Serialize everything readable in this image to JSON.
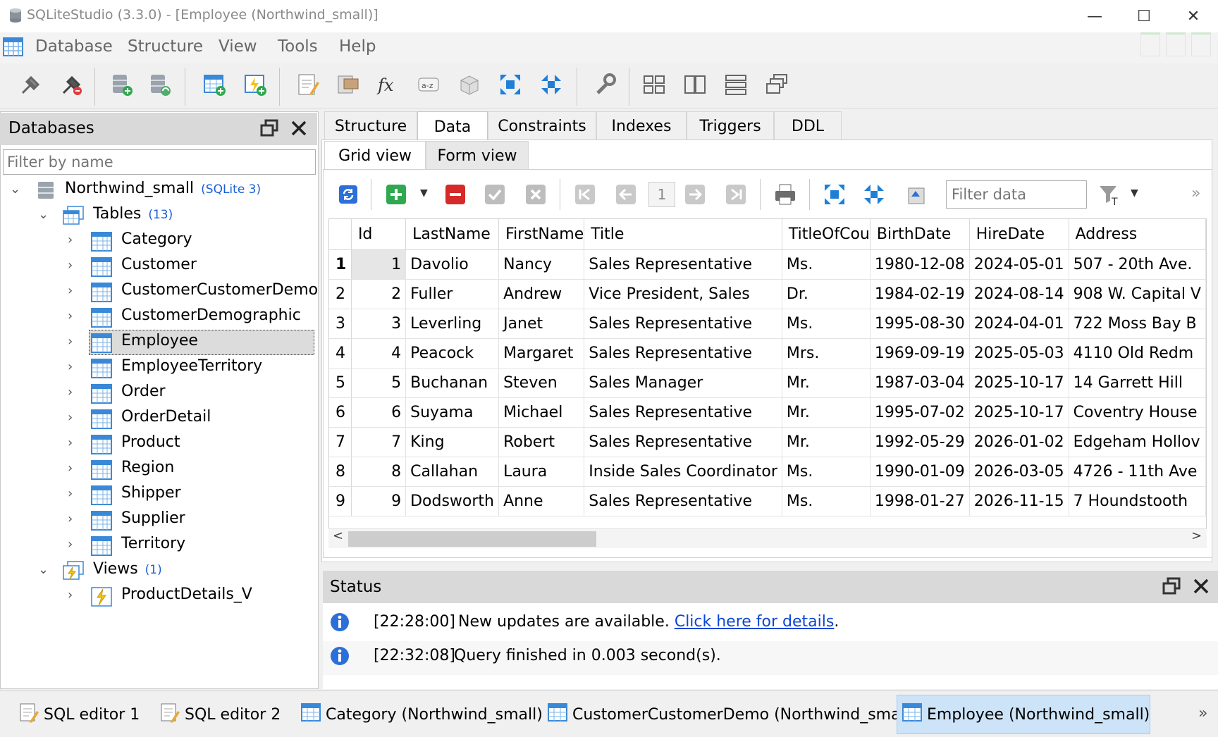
{
  "window": {
    "title": "SQLiteStudio (3.3.0) - [Employee (Northwind_small)]",
    "minimize": "—",
    "maximize": "☐",
    "close": "✕"
  },
  "menu": [
    "Database",
    "Structure",
    "View",
    "Tools",
    "Help"
  ],
  "toolbar_icons": [
    "connect-icon",
    "disconnect-icon",
    "add-database-icon",
    "edit-database-icon",
    "create-table-icon",
    "create-view-icon",
    "sql-editor-icon",
    "edit-structure-icon",
    "functions-icon",
    "collations-icon",
    "extensions-icon",
    "export-icon",
    "import-icon",
    "settings-icon",
    "tile-windows-icon",
    "tile-horizontal-icon",
    "tile-vertical-icon",
    "cascade-windows-icon"
  ],
  "databases_panel": {
    "title": "Databases",
    "filter_placeholder": "Filter by name",
    "database": {
      "name": "Northwind_small",
      "type": "(SQLite 3)"
    },
    "tables_label": "Tables",
    "tables_count": "(13)",
    "tables": [
      "Category",
      "Customer",
      "CustomerCustomerDemo",
      "CustomerDemographic",
      "Employee",
      "EmployeeTerritory",
      "Order",
      "OrderDetail",
      "Product",
      "Region",
      "Shipper",
      "Supplier",
      "Territory"
    ],
    "selected_table": "Employee",
    "views_label": "Views",
    "views_count": "(1)",
    "views": [
      "ProductDetails_V"
    ]
  },
  "tabs": [
    "Structure",
    "Data",
    "Constraints",
    "Indexes",
    "Triggers",
    "DDL"
  ],
  "active_tab": "Data",
  "subtabs": [
    "Grid view",
    "Form view"
  ],
  "active_subtab": "Grid view",
  "grid_toolbar": {
    "page": "1",
    "filter_placeholder": "Filter data",
    "more": "»"
  },
  "grid": {
    "columns": [
      "Id",
      "LastName",
      "FirstName",
      "Title",
      "TitleOfCou",
      "BirthDate",
      "HireDate",
      "Address"
    ],
    "rows": [
      [
        "1",
        "1",
        "Davolio",
        "Nancy",
        "Sales Representative",
        "Ms.",
        "1980-12-08",
        "2024-05-01",
        "507 - 20th Ave."
      ],
      [
        "2",
        "2",
        "Fuller",
        "Andrew",
        "Vice President, Sales",
        "Dr.",
        "1984-02-19",
        "2024-08-14",
        "908 W. Capital V"
      ],
      [
        "3",
        "3",
        "Leverling",
        "Janet",
        "Sales Representative",
        "Ms.",
        "1995-08-30",
        "2024-04-01",
        "722 Moss Bay B"
      ],
      [
        "4",
        "4",
        "Peacock",
        "Margaret",
        "Sales Representative",
        "Mrs.",
        "1969-09-19",
        "2025-05-03",
        "4110 Old Redm"
      ],
      [
        "5",
        "5",
        "Buchanan",
        "Steven",
        "Sales Manager",
        "Mr.",
        "1987-03-04",
        "2025-10-17",
        "14 Garrett Hill"
      ],
      [
        "6",
        "6",
        "Suyama",
        "Michael",
        "Sales Representative",
        "Mr.",
        "1995-07-02",
        "2025-10-17",
        "Coventry House"
      ],
      [
        "7",
        "7",
        "King",
        "Robert",
        "Sales Representative",
        "Mr.",
        "1992-05-29",
        "2026-01-02",
        "Edgeham Hollov"
      ],
      [
        "8",
        "8",
        "Callahan",
        "Laura",
        "Inside Sales Coordinator",
        "Ms.",
        "1990-01-09",
        "2026-03-05",
        "4726 - 11th Ave"
      ],
      [
        "9",
        "9",
        "Dodsworth",
        "Anne",
        "Sales Representative",
        "Ms.",
        "1998-01-27",
        "2026-11-15",
        "7 Houndstooth"
      ]
    ],
    "scroll_left": "<",
    "scroll_right": ">"
  },
  "status": {
    "title": "Status",
    "messages": [
      {
        "time": "[22:28:00]",
        "text": "New updates are available.",
        "link": "Click here for details",
        "suffix": "."
      },
      {
        "time": "[22:32:08]",
        "text": "Query finished in 0.003 second(s).",
        "link": "",
        "suffix": ""
      }
    ]
  },
  "window_tabs": [
    "SQL editor 1",
    "SQL editor 2",
    "Category (Northwind_small)",
    "CustomerCustomerDemo (Northwind_small)",
    "Employee (Northwind_small)"
  ],
  "active_window_tab": "Employee (Northwind_small)",
  "window_tabs_more": "»",
  "colors": {
    "accent_blue": "#1a5fd6",
    "link": "#0b46d6",
    "selected_tab": "#cde3f7",
    "panel_header": "#d9d9d9"
  }
}
